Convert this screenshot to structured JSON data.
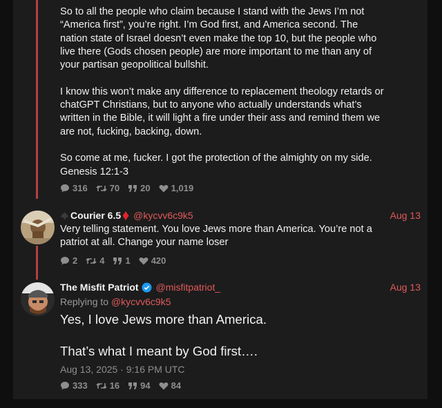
{
  "tweet1": {
    "paragraphs": [
      [
        "So to all the people who claim because I stand with the Jews I’m not",
        "“America first”, you’re right. I’m God first, and America second. The",
        "nation state of Israel doesn’t even make the top 10, but the people who",
        "live there (Gods chosen people) are more important to me than any of",
        "your partisan geopolitical bullshit."
      ],
      [
        "I know this won’t make any difference to replacement theology retards or",
        "chatGPT Christians, but to anyone who actually understands what’s",
        "written in the Bible, it will light a fire under their ass and remind them we",
        "are not, fucking, backing, down."
      ],
      [
        "So come at me, fucker. I got the protection of the almighty on my side.",
        "Genesis 12:1-3"
      ]
    ],
    "stats": {
      "replies": "316",
      "retweets": "70",
      "quotes": "20",
      "likes": "1,019"
    }
  },
  "tweet2": {
    "name": "Courier 6.5",
    "handle": "@kycvv6c9k5",
    "date": "Aug 13",
    "lines": [
      "Very telling statement. You love Jews more than America. You’re not a",
      "patriot at all. Change your name loser"
    ],
    "stats": {
      "replies": "2",
      "retweets": "4",
      "quotes": "1",
      "likes": "420"
    }
  },
  "tweet3": {
    "name": "The Misfit Patriot",
    "handle": "@misfitpatriot_",
    "date": "Aug 13",
    "replying_prefix": "Replying to",
    "replying_handle": "@kycvv6c9k5",
    "line1": "Yes, I love Jews more than America.",
    "line2": "That’s what I meant by God first….",
    "timestamp": "Aug 13, 2025 · 9:16 PM UTC",
    "stats": {
      "replies": "333",
      "retweets": "16",
      "quotes": "94",
      "likes": "84"
    }
  },
  "colors": {
    "accent": "#e05a58",
    "thread": "#b5413f",
    "verified": "#1d9bf0",
    "muted": "#8e8e90"
  },
  "icons": {
    "reply": "comment-icon",
    "retweet": "retweet-icon",
    "quote": "quote-icon",
    "like": "heart-icon",
    "verified": "verified-badge-icon"
  }
}
